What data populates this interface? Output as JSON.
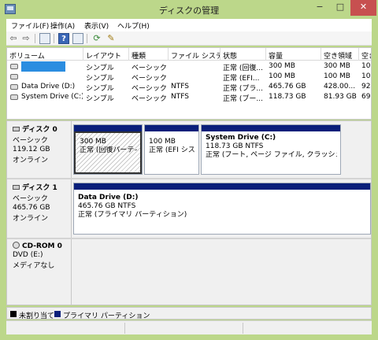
{
  "window": {
    "title": "ディスクの管理",
    "min_glyph": "−",
    "max_glyph": "□",
    "close_glyph": "✕"
  },
  "menu": [
    "ファイル(F)",
    "操作(A)",
    "表示(V)",
    "ヘルプ(H)"
  ],
  "toolbar": {
    "icons": [
      "back-arrow-icon",
      "forward-arrow-icon",
      "console-tree-icon",
      "help-icon",
      "properties-icon",
      "refresh-icon",
      "settings-icon"
    ],
    "back_glyph": "⇦",
    "forward_glyph": "⇨"
  },
  "volume_list": {
    "columns": [
      "ボリューム",
      "レイアウト",
      "種類",
      "ファイル システム",
      "状態",
      "容量",
      "空き領域",
      "空き"
    ],
    "rows": [
      {
        "volume": "",
        "layout": "シンプル",
        "type": "ベーシック",
        "fs": "",
        "status": "正常 (回復...",
        "capacity": "300 MB",
        "free": "300 MB",
        "pct": "100"
      },
      {
        "volume": "",
        "layout": "シンプル",
        "type": "ベーシック",
        "fs": "",
        "status": "正常 (EFI...",
        "capacity": "100 MB",
        "free": "100 MB",
        "pct": "100"
      },
      {
        "volume": "Data Drive (D:)",
        "layout": "シンプル",
        "type": "ベーシック",
        "fs": "NTFS",
        "status": "正常 (プラ...",
        "capacity": "465.76 GB",
        "free": "428.00...",
        "pct": "92"
      },
      {
        "volume": "System Drive (C:)",
        "layout": "シンプル",
        "type": "ベーシック",
        "fs": "NTFS",
        "status": "正常 (ブー...",
        "capacity": "118.73 GB",
        "free": "81.93 GB",
        "pct": "69"
      }
    ]
  },
  "disks": [
    {
      "name": "ディスク 0",
      "type": "ベーシック",
      "size": "119.12 GB",
      "status": "オンライン",
      "partitions": [
        {
          "title": "",
          "line1": "300 MB",
          "line2": "正常 (回復パーティション)"
        },
        {
          "title": "",
          "line1": "100 MB",
          "line2": "正常 (EFI システム パーティション)"
        },
        {
          "title": "System Drive  (C:)",
          "line1": "118.73 GB NTFS",
          "line2": "正常 (ブート, ページ ファイル, クラッシュ ダンプ, プライマリ パーティション)"
        }
      ]
    },
    {
      "name": "ディスク 1",
      "type": "ベーシック",
      "size": "465.76 GB",
      "status": "オンライン",
      "partitions": [
        {
          "title": "Data Drive  (D:)",
          "line1": "465.76 GB NTFS",
          "line2": "正常 (プライマリ パーティション)"
        }
      ]
    },
    {
      "name": "CD-ROM 0",
      "type": "DVD (E:)",
      "size": "",
      "status": "メディアなし",
      "partitions": []
    }
  ],
  "legend": [
    {
      "label": "未割り当て",
      "color": "#000000"
    },
    {
      "label": "プライマリ パーティション",
      "color": "#0a1f7a"
    }
  ],
  "colors": {
    "accent": "#bcd78a",
    "selection": "#2b8de0",
    "partition_bar": "#0a1f7a",
    "close": "#c75050"
  }
}
